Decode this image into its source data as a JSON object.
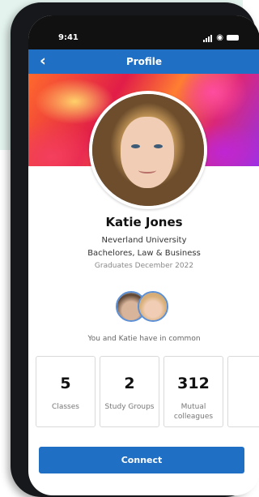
{
  "status": {
    "time": "9:41"
  },
  "nav": {
    "title": "Profile"
  },
  "profile": {
    "name": "Katie Jones",
    "school": "Neverland University",
    "degree": "Bachelores, Law & Business",
    "graduation": "Graduates December 2022"
  },
  "common_text": "You and Katie have in common",
  "stats": [
    {
      "value": "5",
      "label": "Classes"
    },
    {
      "value": "2",
      "label": "Study Groups"
    },
    {
      "value": "312",
      "label": "Mutual colleagues"
    }
  ],
  "connect_label": "Connect",
  "colors": {
    "primary": "#1f6fc4",
    "phone": "#16181b",
    "backdrop": "#e4f3ee"
  }
}
